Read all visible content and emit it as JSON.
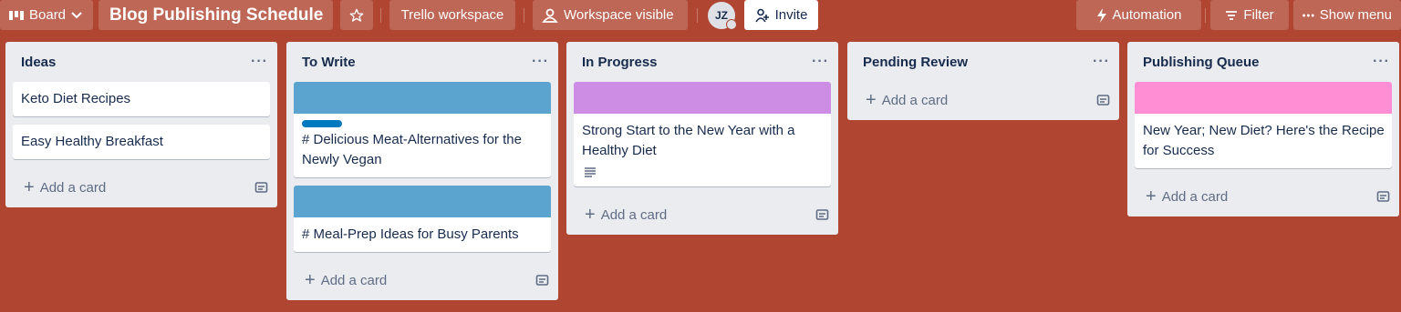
{
  "topbar": {
    "view_switcher": "Board",
    "board_title": "Blog Publishing Schedule",
    "workspace": "Trello workspace",
    "visibility": "Workspace visible",
    "member_initials": "JZ",
    "invite": "Invite",
    "automation": "Automation",
    "filter": "Filter",
    "show_menu": "Show menu"
  },
  "colors": {
    "background": "#b04632",
    "cover_blue": "#5ba4cf",
    "cover_purple": "#cd8de5",
    "cover_pink": "#ff8ed4",
    "label_blue": "#0079bf"
  },
  "add_card_label": "Add a card",
  "list_menu": "···",
  "lists": [
    {
      "title": "Ideas",
      "cards": [
        {
          "title": "Keto Diet Recipes"
        },
        {
          "title": "Easy Healthy Breakfast"
        }
      ]
    },
    {
      "title": "To Write",
      "cards": [
        {
          "title": "# Delicious Meat-Alternatives for the Newly Vegan",
          "cover": "blue",
          "label": "blue"
        },
        {
          "title": "# Meal-Prep Ideas for Busy Parents",
          "cover": "blue"
        }
      ]
    },
    {
      "title": "In Progress",
      "cards": [
        {
          "title": "Strong Start to the New Year with a Healthy Diet",
          "cover": "purple",
          "has_description": true
        }
      ]
    },
    {
      "title": "Pending Review",
      "cards": []
    },
    {
      "title": "Publishing Queue",
      "cards": [
        {
          "title": "New Year; New Diet? Here's the Recipe for Success",
          "cover": "pink"
        }
      ]
    }
  ]
}
